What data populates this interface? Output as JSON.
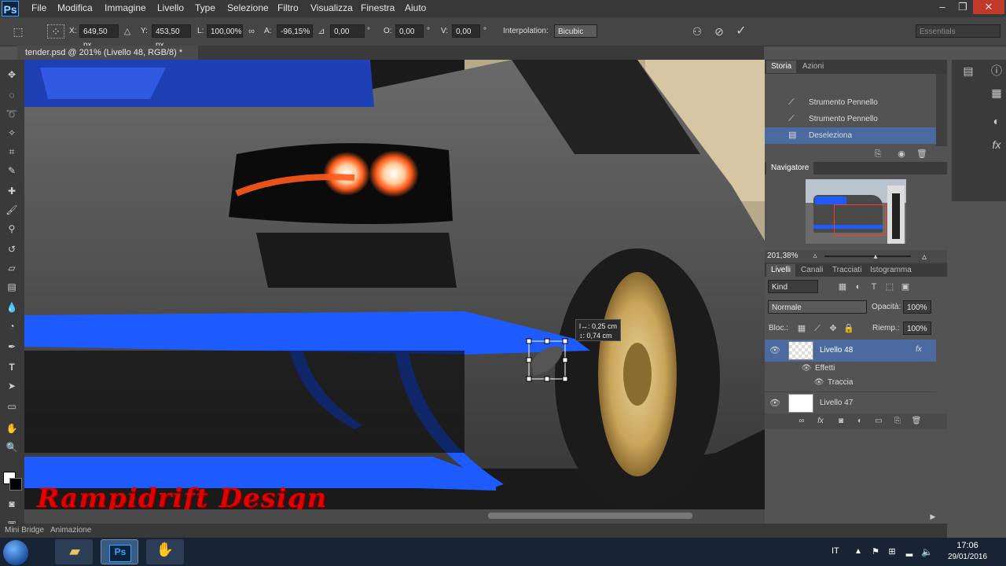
{
  "app": {
    "logo": "Ps"
  },
  "menu": [
    "File",
    "Modifica",
    "Immagine",
    "Livello",
    "Type",
    "Selezione",
    "Filtro",
    "Visualizza",
    "Finestra",
    "Aiuto"
  ],
  "window_controls": [
    "–",
    "❐",
    "✕"
  ],
  "options": {
    "x_label": "X:",
    "x_value": "649,50 px",
    "y_label": "Y:",
    "y_value": "453,50 px",
    "w_label": "L:",
    "w_value": "100,00%",
    "h_label": "A:",
    "h_value": "-96,15%",
    "angle_value": "0,00",
    "h_skew_label": "O:",
    "h_skew_value": "0,00",
    "v_skew_label": "V:",
    "v_skew_value": "0,00",
    "degree_symbol": "°",
    "interp_label": "Interpolation:",
    "interp_value": "Bicubic",
    "workspace": "Essentials"
  },
  "document_tab": "tender.psd @ 201% (Livello 48, RGB/8) *",
  "transform_readout": {
    "line1": "l↔: 0,25 cm",
    "line2": "↕: 0,74 cm"
  },
  "history_panel": {
    "tabs": [
      "Storia",
      "Azioni"
    ],
    "items": [
      {
        "label": "Strumento Pennello",
        "selected": false
      },
      {
        "label": "Strumento Pennello",
        "selected": false
      },
      {
        "label": "Deseleziona",
        "selected": true
      }
    ]
  },
  "navigator_panel": {
    "title": "Navigatore",
    "zoom": "201,38%"
  },
  "layers_panel": {
    "tabs": [
      "Livelli",
      "Canali",
      "Tracciati",
      "Istogramma"
    ],
    "filter": "Kind",
    "blend_mode": "Normale",
    "opacity_label": "Opacità:",
    "opacity_value": "100%",
    "lock_label": "Bloc.:",
    "fill_label": "Riemp.:",
    "fill_value": "100%",
    "layers": [
      {
        "name": "Livello 48",
        "selected": true,
        "fx": "fx"
      },
      {
        "name": "Effetti",
        "sub": true
      },
      {
        "name": "Traccia",
        "sub": true
      },
      {
        "name": "Livello 47",
        "selected": false
      }
    ]
  },
  "status": {
    "zoom": "201,38%"
  },
  "bottom_tabs": [
    "Mini Bridge",
    "Animazione"
  ],
  "watermark": "Rampidrift Design",
  "taskbar": {
    "lang": "IT",
    "time": "17:06",
    "date": "29/01/2016"
  },
  "colors": {
    "accent_blue": "#1e5bff",
    "tail_light": "#ff5a1a",
    "selection": "#4a6aa0",
    "rim_gold": "#c9a55b"
  }
}
